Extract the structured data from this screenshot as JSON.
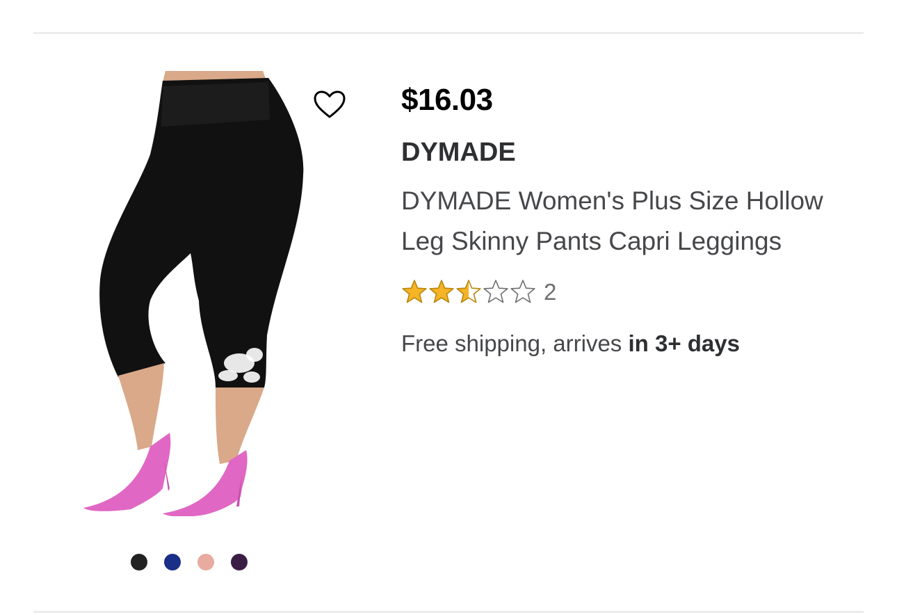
{
  "product": {
    "price": "$16.03",
    "brand": "DYMADE",
    "title": "DYMADE Women's Plus Size Hollow Leg Skinny Pants Capri Leggings",
    "rating": 2.5,
    "rating_max": 5,
    "review_count": "2",
    "shipping_prefix": "Free shipping, arrives ",
    "shipping_emphasis": "in 3+ days",
    "favorite_icon": "heart-outline-icon",
    "image_icon": "product-photo"
  },
  "swatches": [
    {
      "name": "black",
      "color": "#222222"
    },
    {
      "name": "navy",
      "color": "#1a2f87"
    },
    {
      "name": "pink",
      "color": "#e8ab9f"
    },
    {
      "name": "purple",
      "color": "#3a1d44"
    }
  ],
  "colors": {
    "star": "#f5b326",
    "star_stroke": "#b8860b",
    "star_empty": "#6d6e71"
  }
}
